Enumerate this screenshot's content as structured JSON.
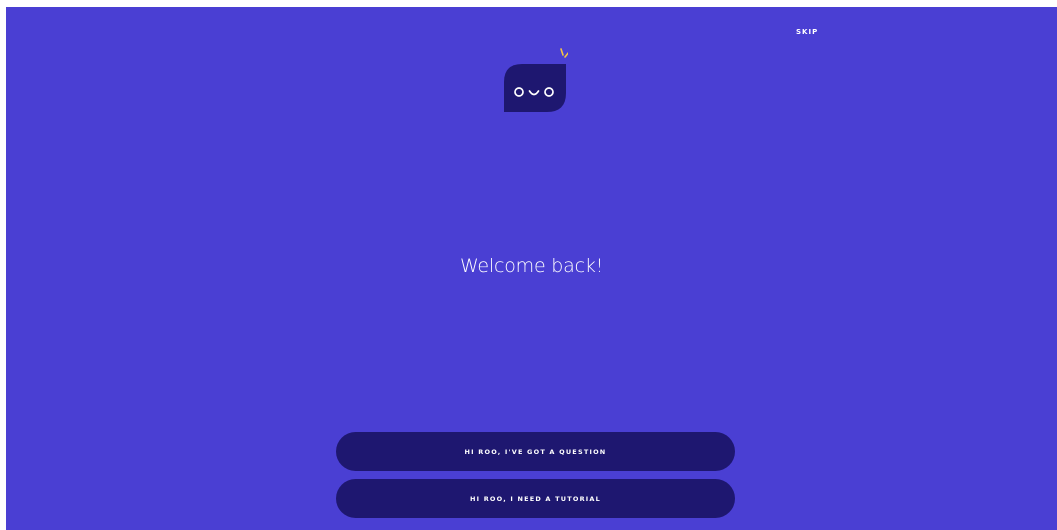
{
  "header": {
    "skip_label": "SKIP"
  },
  "mascot": {
    "icon": "roo-bot-avatar-icon"
  },
  "main": {
    "greeting": "Welcome back!"
  },
  "actions": {
    "question_label": "HI ROO, I'VE GOT A QUESTION",
    "tutorial_label": "HI ROO, I NEED A TUTORIAL"
  },
  "colors": {
    "background": "#4a3fd3",
    "button": "#1e1770",
    "mascot_body": "#1e1770",
    "sparkle": "#f5c542",
    "text": "#ffffff"
  }
}
